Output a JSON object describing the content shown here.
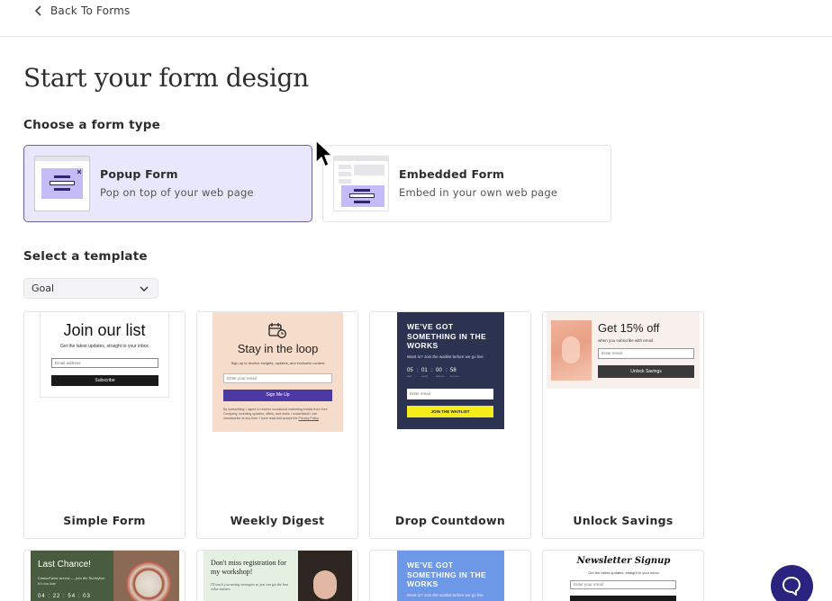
{
  "nav": {
    "back_label": "Back To Forms"
  },
  "page": {
    "title": "Start your form design",
    "form_type_heading": "Choose a form type",
    "template_heading": "Select a template"
  },
  "form_types": [
    {
      "name": "Popup Form",
      "description": "Pop on top of your web page",
      "selected": true
    },
    {
      "name": "Embedded Form",
      "description": "Embed in your own web page",
      "selected": false
    }
  ],
  "filter": {
    "value": "Goal"
  },
  "templates": [
    {
      "name": "Simple Form",
      "preview": {
        "heading": "Join our list",
        "subtext": "Get the latest updates, straight to your inbox",
        "placeholder": "Email address",
        "button": "Subscribe"
      }
    },
    {
      "name": "Weekly Digest",
      "preview": {
        "heading": "Stay in the loop",
        "subtext": "Sign up to receive insights, updates, and exclusive content",
        "placeholder": "Enter your email",
        "button": "Sign Me Up",
        "fine_print": "By subscribing, I agree to receive occasional marketing emails from Your Company, including updates, offers, and news. I understand I can unsubscribe at any time. I have read and accept the",
        "link": "Privacy Policy"
      }
    },
    {
      "name": "Drop Countdown",
      "preview": {
        "heading": "WE'VE GOT SOMETHING IN THE WORKS",
        "subtext": "Want in? Join the waitlist before we go live.",
        "countdown": [
          "05",
          "01",
          "00",
          "58"
        ],
        "countdown_labels": [
          "DAYS",
          "HOURS",
          "MINUTES",
          "SECONDS"
        ],
        "placeholder": "Enter email",
        "button": "JOIN THE WAITLIST"
      }
    },
    {
      "name": "Unlock Savings",
      "preview": {
        "heading": "Get 15% off",
        "subtext": "when you subscribe with email.",
        "placeholder": "Enter email",
        "button": "Unlock Savings"
      }
    }
  ],
  "templates_row2": [
    {
      "preview": {
        "heading": "Last Chance!",
        "subtext": "Limited time access — join the list before it's too late",
        "countdown": [
          "04",
          "22",
          "54",
          "03"
        ]
      }
    },
    {
      "preview": {
        "heading": "Don't miss registration for my workshop!",
        "subtext": "I'll teach you saving strategies so you can get the best value matters"
      }
    },
    {
      "preview": {
        "heading": "WE'VE GOT SOMETHING IN THE WORKS",
        "subtext": "Want in? Join the waitlist before we go live."
      }
    },
    {
      "preview": {
        "heading": "Newsletter Signup",
        "subtext": "Get the latest updates, straight to your inbox",
        "placeholder": "Enter your email"
      }
    }
  ],
  "colors": {
    "accent": "#4b3aa3",
    "selected_bg": "#e8e7fb",
    "help_button": "#2a2380",
    "countdown_bg": "#2b3350",
    "countdown_button": "#f5ec1a",
    "digest_bg": "#f6dccb"
  },
  "icons": [
    "chevron-left-icon",
    "chevron-down-icon",
    "calendar-clock-icon",
    "close-icon",
    "chat-bubble-icon",
    "mouse-pointer-icon"
  ]
}
